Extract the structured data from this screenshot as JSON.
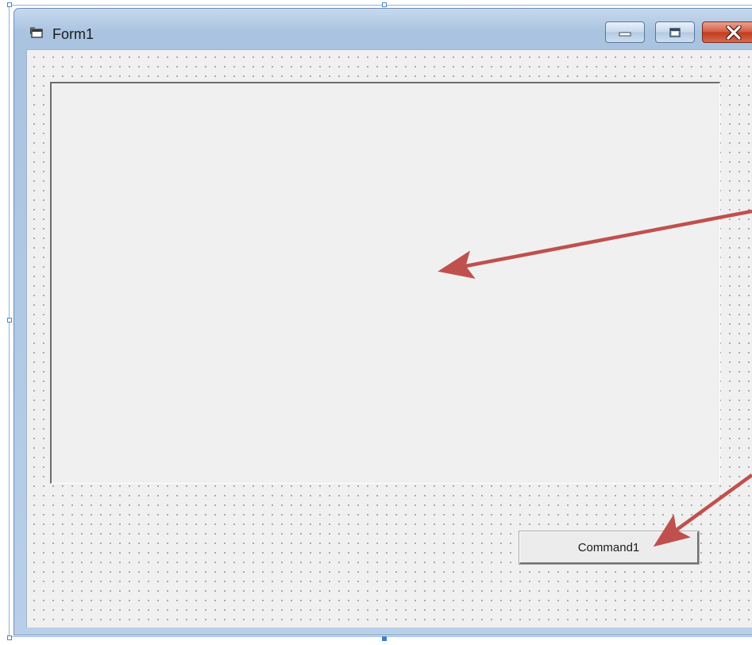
{
  "window": {
    "title": "Form1",
    "icon": "form-icon",
    "controls": {
      "minimize_icon": "minimize-icon",
      "maximize_icon": "maximize-icon",
      "close_icon": "close-icon"
    }
  },
  "form": {
    "picturebox": {
      "icon": "picturebox-control"
    },
    "command_button": {
      "label": "Command1"
    }
  },
  "annotations": {
    "arrow_color": "#c0504d"
  }
}
